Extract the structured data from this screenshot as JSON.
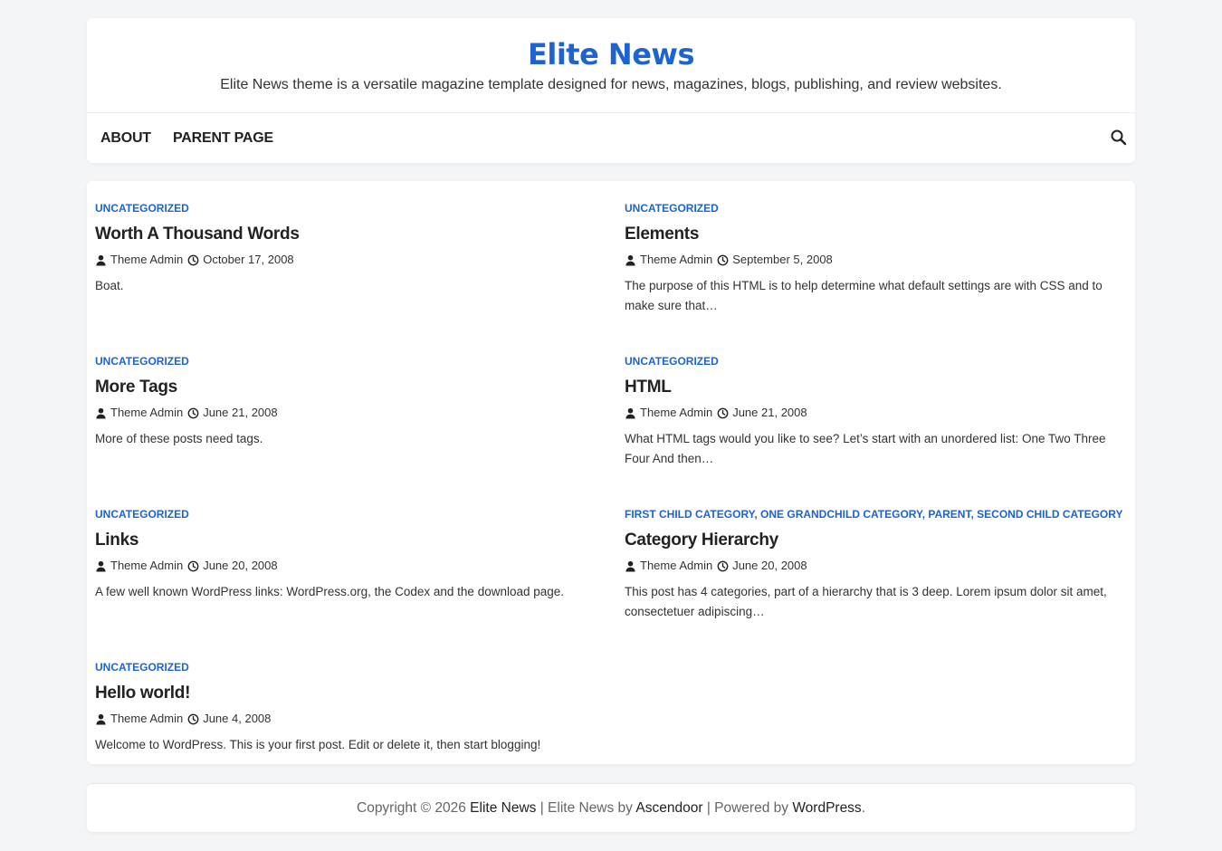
{
  "site": {
    "title": "Elite News",
    "description": "Elite News theme is a versatile magazine template designed for news, magazines, blogs, publishing, and review websites."
  },
  "nav": {
    "items": [
      "About",
      "Parent Page"
    ],
    "search_icon": "search-icon"
  },
  "posts": [
    {
      "categories": [
        "UNCATEGORIZED"
      ],
      "title": "Worth A Thousand Words",
      "author": "Theme Admin",
      "date": "October 17, 2008",
      "excerpt": "Boat."
    },
    {
      "categories": [
        "UNCATEGORIZED"
      ],
      "title": "Elements",
      "author": "Theme Admin",
      "date": "September 5, 2008",
      "excerpt": "The purpose of this HTML is to help determine what default settings are with CSS and to make sure that…"
    },
    {
      "categories": [
        "UNCATEGORIZED"
      ],
      "title": "More Tags",
      "author": "Theme Admin",
      "date": "June 21, 2008",
      "excerpt": "More of these posts need tags."
    },
    {
      "categories": [
        "UNCATEGORIZED"
      ],
      "title": "HTML",
      "author": "Theme Admin",
      "date": "June 21, 2008",
      "excerpt": "What HTML tags would you like to see? Let’s start with an unordered list: One Two Three Four And then…"
    },
    {
      "categories": [
        "UNCATEGORIZED"
      ],
      "title": "Links",
      "author": "Theme Admin",
      "date": "June 20, 2008",
      "excerpt": "A few well known WordPress links: WordPress.org, the Codex and the download page."
    },
    {
      "categories": [
        "FIRST CHILD CATEGORY",
        "ONE GRANDCHILD CATEGORY",
        "PARENT",
        "SECOND CHILD CATEGORY"
      ],
      "category_separator": ", ",
      "title": "Category Hierarchy",
      "author": "Theme Admin",
      "date": "June 20, 2008",
      "excerpt": "This post has 4 categories, part of a hierarchy that is 3 deep. Lorem ipsum dolor sit amet, consectetuer adipiscing…"
    },
    {
      "categories": [
        "UNCATEGORIZED"
      ],
      "title": "Hello world!",
      "author": "Theme Admin",
      "date": "June 4, 2008",
      "excerpt": "Welcome to WordPress. This is your first post. Edit or delete it, then start blogging!"
    }
  ],
  "footer": {
    "copyright_prefix": "Copyright © 2026",
    "site_link": "Elite News",
    "theme_text": "| Elite News by",
    "author_link": "Ascendoor",
    "powered_text": "| Powered by",
    "wp_link": "WordPress",
    "end": "."
  },
  "colors": {
    "accent": "#1e63cf",
    "text": "#222222",
    "background": "#f4f5f6"
  }
}
